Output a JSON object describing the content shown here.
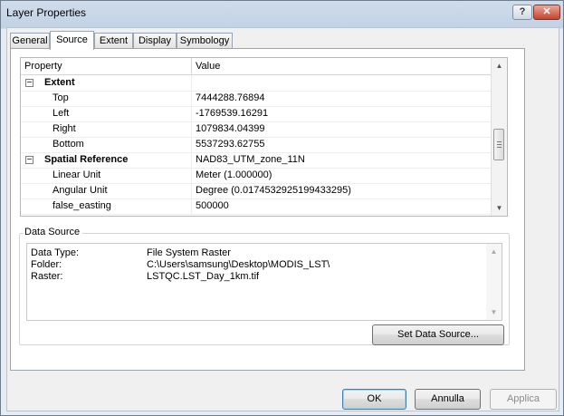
{
  "window": {
    "title": "Layer Properties",
    "help_label": "?",
    "close_label": "✕"
  },
  "tabs": [
    "General",
    "Source",
    "Extent",
    "Display",
    "Symbology"
  ],
  "active_tab": "Source",
  "grid": {
    "headers": {
      "property": "Property",
      "value": "Value"
    },
    "rows": [
      {
        "property": "Extent",
        "value": "",
        "category": true,
        "expander": "−"
      },
      {
        "property": "Top",
        "value": "7444288.76894"
      },
      {
        "property": "Left",
        "value": "-1769539.16291"
      },
      {
        "property": "Right",
        "value": "1079834.04399"
      },
      {
        "property": "Bottom",
        "value": "5537293.62755"
      },
      {
        "property": "Spatial Reference",
        "value": "NAD83_UTM_zone_11N",
        "category": true,
        "expander": "−"
      },
      {
        "property": "Linear Unit",
        "value": "Meter (1.000000)"
      },
      {
        "property": "Angular Unit",
        "value": "Degree (0.0174532925199433295)"
      },
      {
        "property": "false_easting",
        "value": "500000"
      }
    ],
    "scroll_up": "▲",
    "scroll_down": "▼"
  },
  "data_source": {
    "label": "Data Source",
    "lines": [
      {
        "key": "Data Type:",
        "value": "File System Raster"
      },
      {
        "key": "Folder:",
        "value": "C:\\Users\\samsung\\Desktop\\MODIS_LST\\"
      },
      {
        "key": "Raster:",
        "value": "LSTQC.LST_Day_1km.tif"
      }
    ],
    "set_button": "Set Data Source..."
  },
  "footer": {
    "ok": "OK",
    "cancel": "Annulla",
    "apply": "Applica"
  }
}
